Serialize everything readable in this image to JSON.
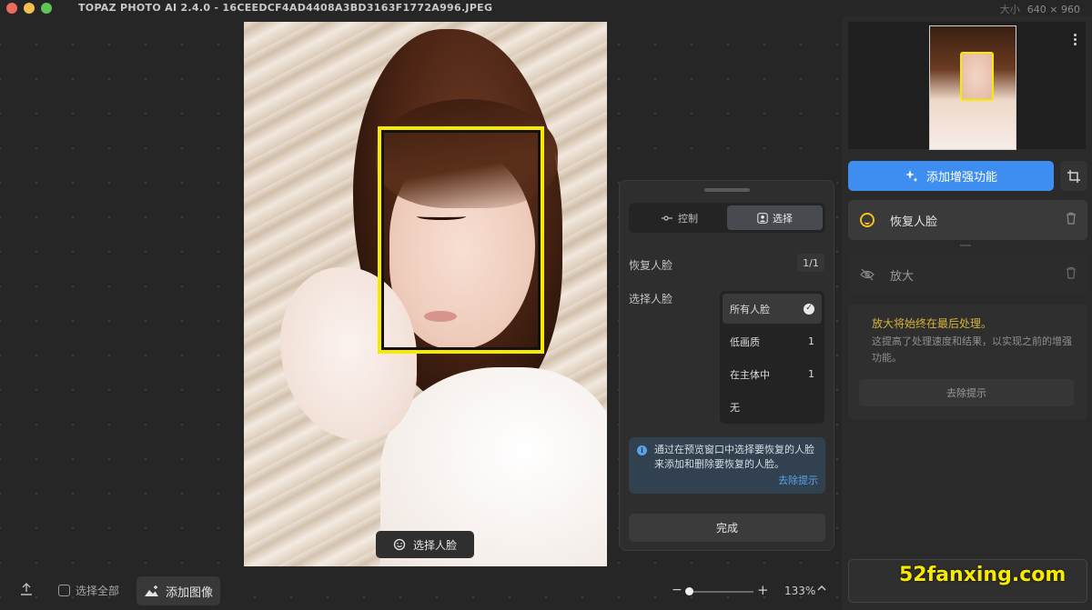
{
  "window": {
    "title": "TOPAZ PHOTO AI 2.4.0 - 16CEEDCF4AD4408A3BD3163F1772A996.JPEG",
    "size_label": "大小",
    "size_value": "640 × 960"
  },
  "canvas": {
    "select_face_label": "选择人脸",
    "face_box_color": "#f7ea00"
  },
  "popover": {
    "tabs": [
      {
        "label": "控制",
        "icon": "sliders-icon",
        "active": false
      },
      {
        "label": "选择",
        "icon": "person-icon",
        "active": true
      }
    ],
    "restore_face_label": "恢复人脸",
    "restore_face_count": "1/1",
    "select_face_label": "选择人脸",
    "face_options": [
      {
        "label": "所有人脸",
        "count": "",
        "selected": true
      },
      {
        "label": "低画质",
        "count": "1",
        "selected": false
      },
      {
        "label": "在主体中",
        "count": "1",
        "selected": false
      },
      {
        "label": "无",
        "count": "",
        "selected": false
      }
    ],
    "tip_text": "通过在预览窗口中选择要恢复的人脸来添加和删除要恢复的人脸。",
    "tip_link": "去除提示",
    "done_label": "完成"
  },
  "sidebar": {
    "add_enhancement_label": "添加增强功能",
    "accent_color": "#3d8ef0",
    "enhancements": [
      {
        "label": "恢复人脸",
        "icon": "smile-icon",
        "enabled": true
      },
      {
        "label": "放大",
        "icon": "eye-slash-icon",
        "enabled": false
      }
    ],
    "note_title": "放大将始终在最后处理。",
    "note_body": "这提高了处理速度和结果，以实现之前的增强功能。",
    "note_button": "去除提示"
  },
  "toolbar": {
    "select_all_label": "选择全部",
    "add_image_label": "添加图像",
    "zoom_value": "133%",
    "zoom_minus": "−",
    "zoom_plus": "+"
  },
  "watermark": "52fanxing.com"
}
